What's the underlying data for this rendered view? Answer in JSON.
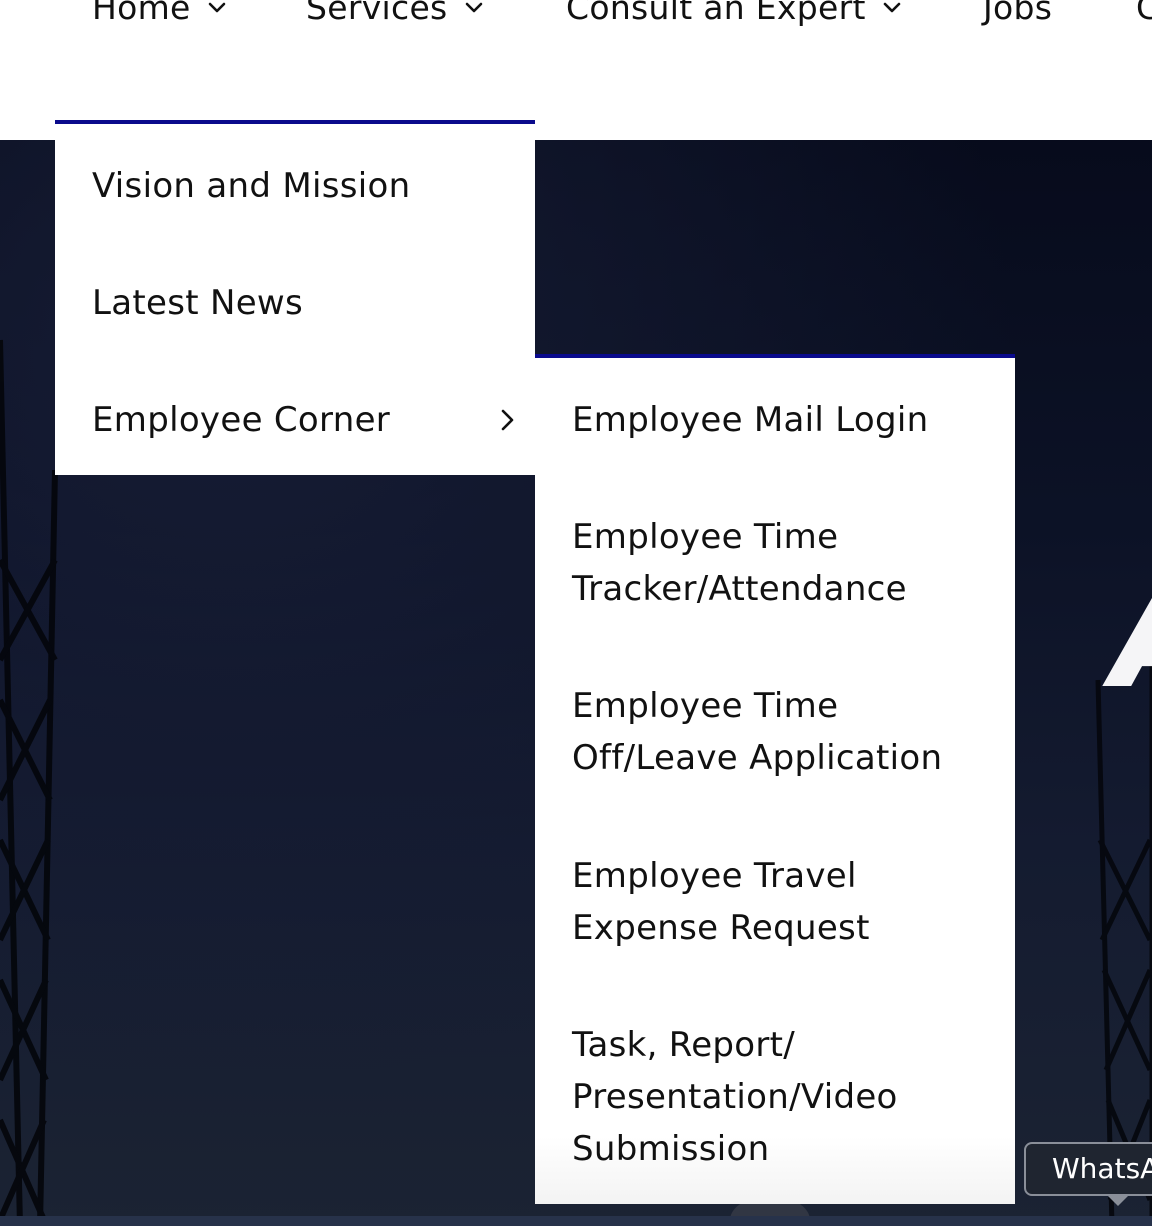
{
  "nav": {
    "items": [
      {
        "label": "Home",
        "has_dropdown": true
      },
      {
        "label": "Services",
        "has_dropdown": true
      },
      {
        "label": "Consult an Expert",
        "has_dropdown": true
      },
      {
        "label": "Jobs",
        "has_dropdown": false
      },
      {
        "label": "C",
        "has_dropdown": false
      }
    ]
  },
  "home_menu": {
    "items": [
      {
        "label": "Vision and Mission"
      },
      {
        "label": "Latest News"
      },
      {
        "label": "Employee Corner",
        "has_submenu": true
      }
    ]
  },
  "employee_corner_menu": {
    "items": [
      {
        "label": "Employee Mail Login"
      },
      {
        "label": "Employee Time\nTracker/Attendance"
      },
      {
        "label": "Employee Time\nOff/Leave Application"
      },
      {
        "label": "Employee Travel\nExpense Request"
      },
      {
        "label": "Task, Report/\nPresentation/Video\nSubmission"
      }
    ]
  },
  "hero": {
    "partial_heading": "A"
  },
  "whatsapp": {
    "tooltip": "WhatsApp"
  },
  "colors": {
    "accent_border": "#0a0a8c",
    "hero_dark": "#0a0f22",
    "text": "#111111",
    "tooltip_bg": "#1f2530"
  },
  "icons": [
    "chevron-down-icon",
    "chevron-right-icon"
  ]
}
